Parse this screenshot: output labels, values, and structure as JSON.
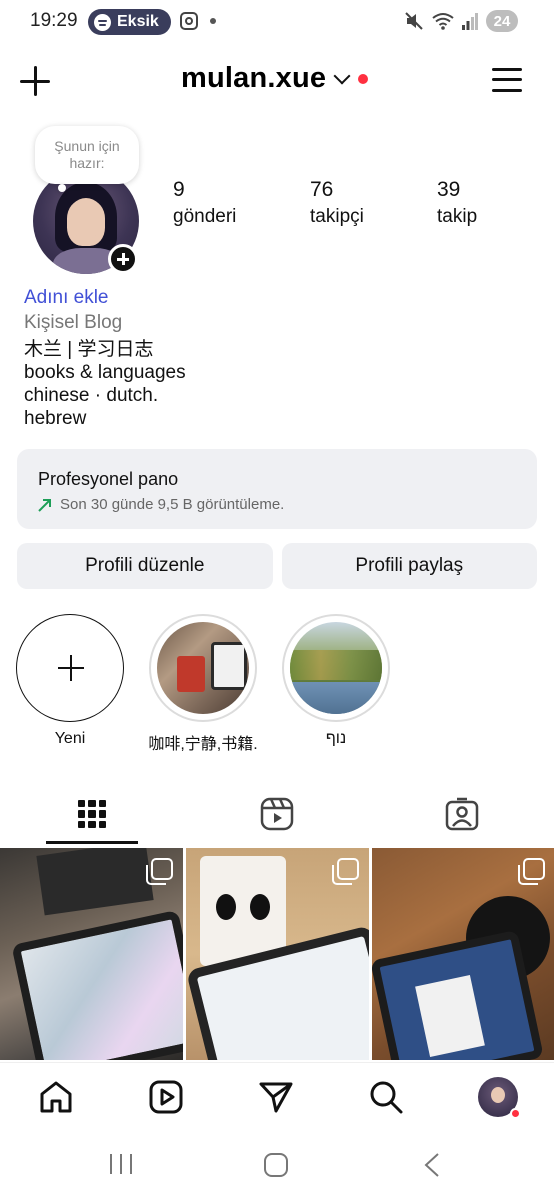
{
  "status_bar": {
    "time": "19:29",
    "spotify_label": "Eksik",
    "battery": "24"
  },
  "header": {
    "username": "mulan.xue"
  },
  "profile": {
    "note_text": "Şunun için hazır:",
    "stats": [
      {
        "value": "9",
        "label": "gönderi"
      },
      {
        "value": "76",
        "label": "takipçi"
      },
      {
        "value": "39",
        "label": "takip"
      }
    ],
    "add_name": "Adını ekle",
    "category": "Kişisel Blog",
    "bio_lines": [
      "木兰 | 学习日志",
      "books & languages",
      "chinese · dutch.",
      "hebrew"
    ]
  },
  "pro_dashboard": {
    "title": "Profesyonel pano",
    "subtitle": "Son 30 günde 9,5 B görüntüleme."
  },
  "buttons": {
    "edit_profile": "Profili düzenle",
    "share_profile": "Profili paylaş"
  },
  "highlights": [
    {
      "label": "Yeni"
    },
    {
      "label": "咖啡,宁静,书籍."
    },
    {
      "label": "נוף"
    }
  ],
  "tabs": [
    {
      "icon": "grid-icon"
    },
    {
      "icon": "reels-icon"
    },
    {
      "icon": "tagged-icon"
    }
  ],
  "posts": [
    {
      "icon": "multi-photo-icon"
    },
    {
      "icon": "multi-photo-icon"
    },
    {
      "icon": "multi-photo-icon"
    }
  ],
  "bottom_nav": [
    "home-icon",
    "reels-icon",
    "send-icon",
    "search-icon",
    "profile-avatar"
  ],
  "colors": {
    "link_blue": "#4150d6",
    "notification_red": "#ff3040",
    "button_bg": "#eff0f3",
    "spotify_pill": "#3a3d5c"
  }
}
